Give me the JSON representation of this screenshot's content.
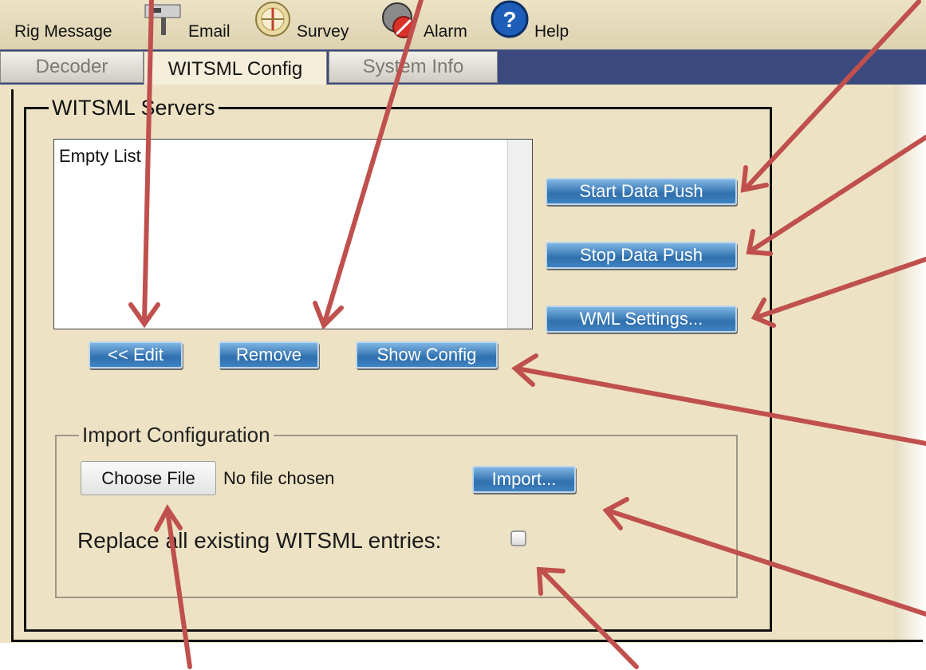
{
  "toolbar": {
    "items": [
      {
        "label": "Rig Message",
        "icon": "rig-message-icon"
      },
      {
        "label": "Email",
        "icon": "email-icon"
      },
      {
        "label": "Survey",
        "icon": "survey-icon"
      },
      {
        "label": "Alarm",
        "icon": "alarm-icon"
      },
      {
        "label": "Help",
        "icon": "help-icon"
      }
    ]
  },
  "tabs": [
    {
      "label": "Decoder"
    },
    {
      "label": "WITSML Config",
      "active": true
    },
    {
      "label": "System Info"
    }
  ],
  "servers": {
    "legend": "WITSML Servers",
    "list_empty_text": "Empty List",
    "edit_label": "<< Edit",
    "remove_label": "Remove",
    "show_config_label": "Show Config",
    "start_label": "Start Data Push",
    "stop_label": "Stop Data Push",
    "wml_label": "WML Settings..."
  },
  "import": {
    "legend": "Import Configuration",
    "choose_file_label": "Choose File",
    "no_file_text": "No file chosen",
    "import_label": "Import...",
    "replace_label": "Replace all existing WITSML entries:",
    "replace_checked": false
  },
  "colors": {
    "annotation_arrow": "#c0504d",
    "tab_bar": "#3b4a7e",
    "panel": "#ede3c4",
    "button_blue": "#2f6fad"
  }
}
